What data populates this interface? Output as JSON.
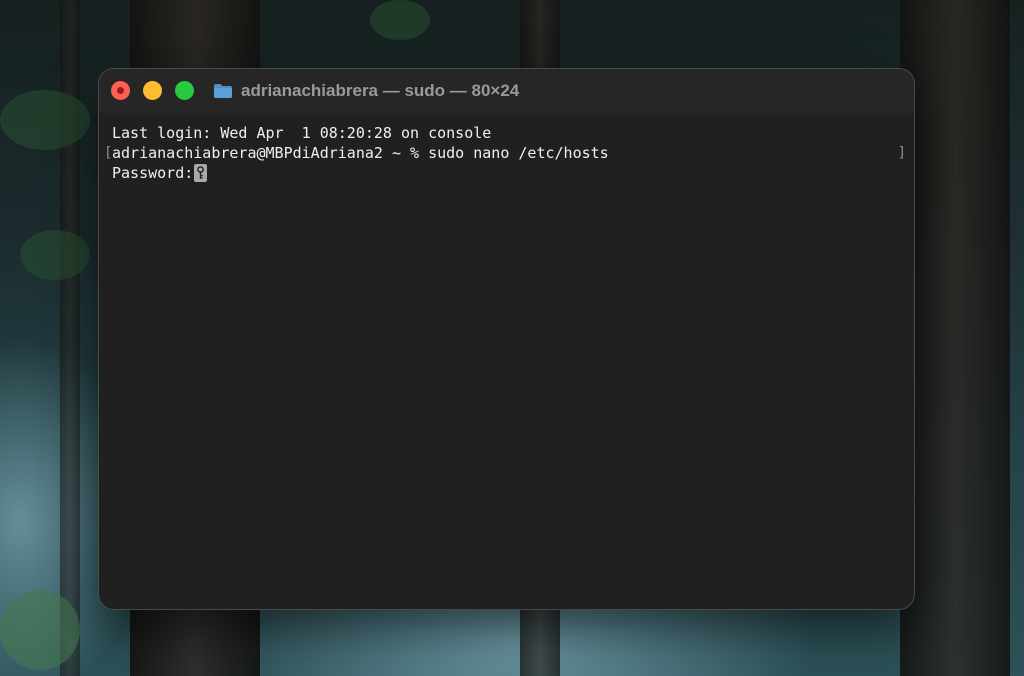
{
  "window": {
    "title": "adrianachiabrera — sudo — 80×24",
    "folder_icon": "folder-icon"
  },
  "terminal": {
    "last_login": "Last login: Wed Apr  1 08:20:28 on console",
    "prompt_line": "adrianachiabrera@MBPdiAdriana2 ~ % sudo nano /etc/hosts",
    "password_prompt": "Password:",
    "line_mark_left": "[",
    "line_mark_right": "]"
  },
  "colors": {
    "close": "#fe5f57",
    "minimize": "#febc2e",
    "zoom": "#28c840",
    "terminal_bg": "#202020",
    "text": "#f0f0f0"
  }
}
